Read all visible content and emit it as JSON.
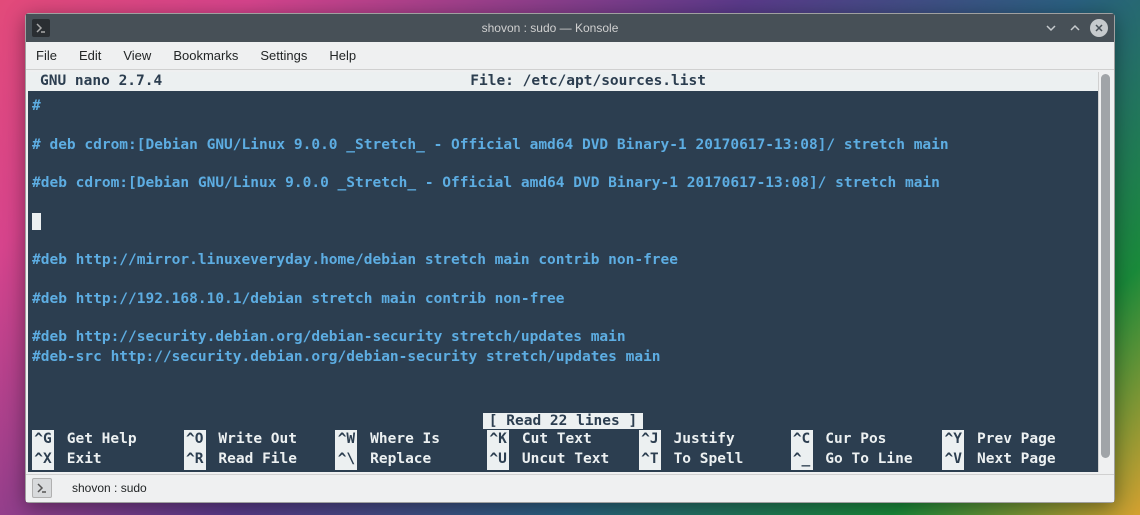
{
  "window": {
    "title": "shovon : sudo — Konsole"
  },
  "menubar": {
    "items": [
      "File",
      "Edit",
      "View",
      "Bookmarks",
      "Settings",
      "Help"
    ]
  },
  "nano": {
    "version": "GNU nano 2.7.4",
    "file_label": "File: /etc/apt/sources.list",
    "lines": [
      "#",
      "",
      "# deb cdrom:[Debian GNU/Linux 9.0.0 _Stretch_ - Official amd64 DVD Binary-1 20170617-13:08]/ stretch main",
      "",
      "#deb cdrom:[Debian GNU/Linux 9.0.0 _Stretch_ - Official amd64 DVD Binary-1 20170617-13:08]/ stretch main",
      "",
      "CURSOR",
      "",
      "#deb http://mirror.linuxeveryday.home/debian stretch main contrib non-free",
      "",
      "#deb http://192.168.10.1/debian stretch main contrib non-free",
      "",
      "#deb http://security.debian.org/debian-security stretch/updates main",
      "#deb-src http://security.debian.org/debian-security stretch/updates main"
    ],
    "status": "[ Read 22 lines ]",
    "shortcuts_row1": [
      {
        "key": "^G",
        "label": "Get Help"
      },
      {
        "key": "^O",
        "label": "Write Out"
      },
      {
        "key": "^W",
        "label": "Where Is"
      },
      {
        "key": "^K",
        "label": "Cut Text"
      },
      {
        "key": "^J",
        "label": "Justify"
      },
      {
        "key": "^C",
        "label": "Cur Pos"
      },
      {
        "key": "^Y",
        "label": "Prev Page"
      }
    ],
    "shortcuts_row2": [
      {
        "key": "^X",
        "label": "Exit"
      },
      {
        "key": "^R",
        "label": "Read File"
      },
      {
        "key": "^\\",
        "label": "Replace"
      },
      {
        "key": "^U",
        "label": "Uncut Text"
      },
      {
        "key": "^T",
        "label": "To Spell"
      },
      {
        "key": "^_",
        "label": "Go To Line"
      },
      {
        "key": "^V",
        "label": "Next Page"
      }
    ]
  },
  "tabbar": {
    "tab_label": "shovon : sudo"
  }
}
